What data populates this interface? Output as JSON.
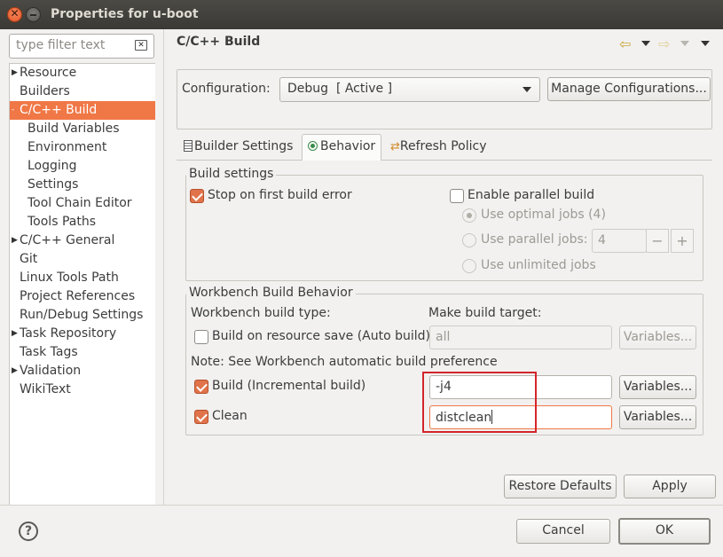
{
  "window": {
    "title": "Properties for u-boot"
  },
  "filter": {
    "placeholder": "type filter text"
  },
  "tree": [
    {
      "label": "Resource",
      "expandable": true
    },
    {
      "label": "Builders",
      "expandable": false
    },
    {
      "label": "C/C++ Build",
      "expandable": true,
      "expanded": true,
      "selected": true
    },
    {
      "label": "Build Variables",
      "child": true
    },
    {
      "label": "Environment",
      "child": true
    },
    {
      "label": "Logging",
      "child": true
    },
    {
      "label": "Settings",
      "child": true
    },
    {
      "label": "Tool Chain Editor",
      "child": true
    },
    {
      "label": "Tools Paths",
      "child": true
    },
    {
      "label": "C/C++ General",
      "expandable": true
    },
    {
      "label": "Git",
      "expandable": false
    },
    {
      "label": "Linux Tools Path",
      "expandable": false
    },
    {
      "label": "Project References",
      "expandable": false
    },
    {
      "label": "Run/Debug Settings",
      "expandable": false
    },
    {
      "label": "Task Repository",
      "expandable": true
    },
    {
      "label": "Task Tags",
      "expandable": false
    },
    {
      "label": "Validation",
      "expandable": true
    },
    {
      "label": "WikiText",
      "expandable": false
    }
  ],
  "page": {
    "title": "C/C++ Build"
  },
  "config": {
    "label": "Configuration:",
    "value": "Debug  [ Active ]",
    "manage_label": "Manage Configurations..."
  },
  "tabs": [
    {
      "label": "Builder Settings",
      "icon": "document-icon"
    },
    {
      "label": "Behavior",
      "icon": "radio-icon",
      "active": true
    },
    {
      "label": "Refresh Policy",
      "icon": "refresh-icon"
    }
  ],
  "build_settings": {
    "title": "Build settings",
    "stop_on_error": "Stop on first build error",
    "parallel": "Enable parallel build",
    "optimal": "Use optimal jobs (4)",
    "parallel_jobs": "Use parallel jobs:",
    "jobs_value": "4",
    "unlimited": "Use unlimited jobs",
    "minus": "−",
    "plus": "+"
  },
  "workbench": {
    "title": "Workbench Build Behavior",
    "type_label": "Workbench build type:",
    "target_label": "Make build target:",
    "auto_label": "Build on resource save (Auto build)",
    "auto_target": "all",
    "note": "Note: See Workbench automatic build preference",
    "incremental_label": "Build (Incremental build)",
    "incremental_target": "-j4",
    "clean_label": "Clean",
    "clean_target": "distclean",
    "variables": "Variables..."
  },
  "buttons": {
    "restore_defaults": "Restore Defaults",
    "apply": "Apply",
    "cancel": "Cancel",
    "ok": "OK"
  },
  "colors": {
    "accent": "#f07746",
    "highlight_border": "#d3252a",
    "titlebar": "#3c3b37"
  }
}
